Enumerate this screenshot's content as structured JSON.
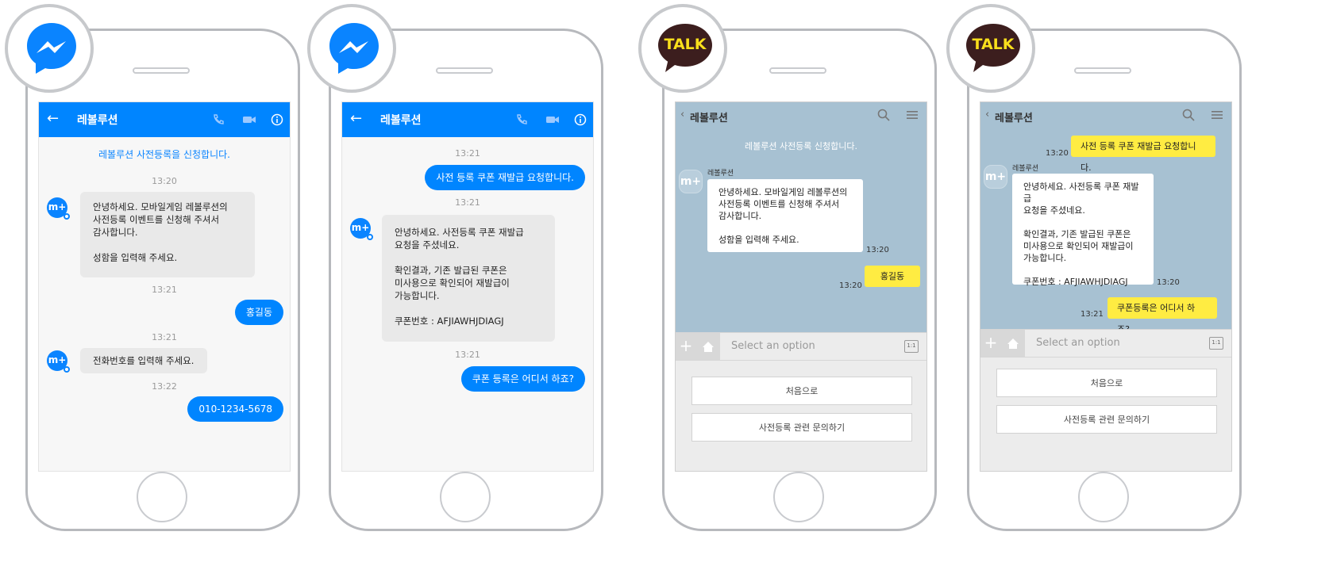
{
  "phones": [
    {
      "app": "Facebook Messenger",
      "header": {
        "title": "레볼루션"
      },
      "intro": "레볼루션 사전등록을 신청합니다.",
      "messages": {
        "t1": "13:20",
        "m1": [
          "안녕하세요. 모바일게임 레볼루션의",
          "사전등록 이벤트를 신청해 주셔서",
          "감사합니다.",
          "",
          "성함을 입력해 주세요."
        ],
        "t2": "13:21",
        "reply1": "홍길동",
        "t3": "13:21",
        "m2": "전화번호를 입력해 주세요.",
        "t4": "13:22",
        "reply2": "010-1234-5678"
      },
      "avatar": "m+"
    },
    {
      "app": "Facebook Messenger",
      "header": {
        "title": "레볼루션"
      },
      "messages": {
        "t1": "13:21",
        "reply1": "사전 등록 쿠폰 재발급 요청합니다.",
        "t2": "13:21",
        "m1": [
          "안녕하세요. 사전등록 쿠폰 재발급",
          "요청을 주셨네요.",
          "",
          "확인결과, 기존 발급된 쿠폰은",
          "미사용으로 확인되어 재발급이",
          "가능합니다.",
          "",
          "쿠폰번호 : AFJIAWHJDIAGJ"
        ],
        "t3": "13:21",
        "reply2": "쿠폰 등록은 어디서 하죠?"
      },
      "avatar": "m+"
    },
    {
      "app": "KakaoTalk",
      "logo_text": "TALK",
      "header": {
        "title": "레볼루션"
      },
      "intro": "레볼루션 사전등록 신청합니다.",
      "sender": "레볼루션",
      "messages": {
        "m1": [
          "안녕하세요. 모바일게임 레볼루션의",
          "사전등록 이벤트를 신청해 주셔서",
          "감사합니다.",
          "",
          "성함을 입력해 주세요."
        ],
        "m1_time": "13:20",
        "reply1": "홍길동",
        "reply1_time": "13:20"
      },
      "input_placeholder": "Select an option",
      "options": [
        "처음으로",
        "사전등록 관련 문의하기"
      ],
      "avatar": "m+"
    },
    {
      "app": "KakaoTalk",
      "logo_text": "TALK",
      "header": {
        "title": "레볼루션"
      },
      "sender": "레볼루션",
      "messages": {
        "reply1": "사전 등록 쿠폰 재발급 요청합니다.",
        "reply1_time": "13:20",
        "m1": [
          "안녕하세요. 사전등록 쿠폰 재발급",
          "요청을 주셨네요.",
          "",
          "확인결과, 기존 발급된 쿠폰은",
          "미사용으로 확인되어 재발급이",
          "가능합니다.",
          "",
          "쿠폰번호 : AFJIAWHJDIAGJ"
        ],
        "m1_time": "13:20",
        "reply2": "쿠폰등록은 어디서 하죠?",
        "reply2_time": "13:21"
      },
      "input_placeholder": "Select an option",
      "options": [
        "처음으로",
        "사전등록 관련 문의하기"
      ],
      "avatar": "m+"
    }
  ],
  "colors": {
    "messenger_blue": "#0085ff",
    "kakao_bg": "#a7c1d2",
    "kakao_yellow": "#ffec42",
    "kakao_brown": "#3c1e1e"
  },
  "icons": [
    "messenger-logo-icon",
    "kakaotalk-logo-icon",
    "back-arrow-icon",
    "phone-icon",
    "video-icon",
    "info-icon",
    "search-icon",
    "menu-icon",
    "plus-icon",
    "home-icon",
    "keyboard-icon"
  ]
}
